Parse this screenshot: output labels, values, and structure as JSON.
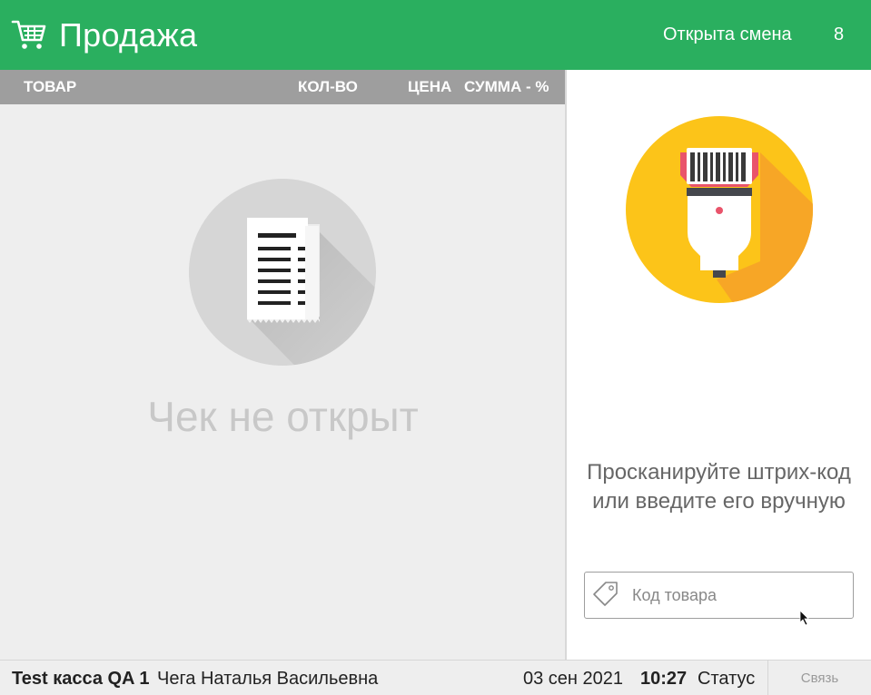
{
  "header": {
    "title": "Продажа",
    "shift_status": "Открыта смена",
    "shift_number": "8",
    "icon": "cart-icon"
  },
  "receipt_table": {
    "columns": [
      "ТОВАР",
      "КОЛ-ВО",
      "ЦЕНА",
      "СУММА - %"
    ],
    "empty_message": "Чек не открыт",
    "empty_icon": "receipt-icon"
  },
  "scanner": {
    "icon": "barcode-scanner-icon",
    "hint": "Просканируйте штрих-код или введите его вручную",
    "input": {
      "placeholder": "Код товара",
      "value": "",
      "icon": "price-tag-icon"
    }
  },
  "status_bar": {
    "register_name": "Test касса QA 1",
    "cashier": "Чега Наталья Васильевна",
    "date": "03 сен 2021",
    "time": "10:27",
    "status_label": "Статус",
    "connection_label": "Связь"
  },
  "colors": {
    "header_bg": "#2aaf5f",
    "column_header_bg": "#9e9e9e",
    "left_pane_bg": "#eeeeee",
    "scanner_circle": "#fcc419",
    "scanner_head": "#e9546b"
  }
}
